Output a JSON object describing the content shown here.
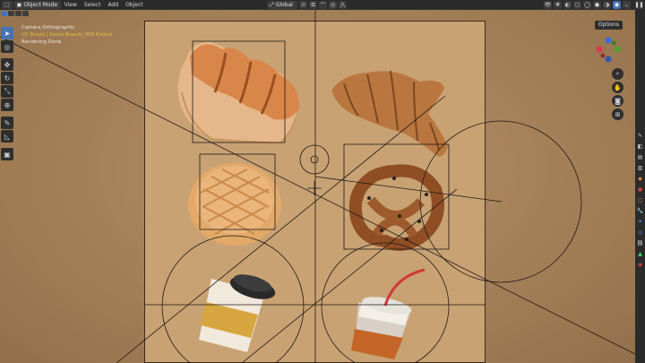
{
  "header": {
    "mode": "Object Mode",
    "menus": [
      "View",
      "Select",
      "Add",
      "Object"
    ],
    "orientation": "Global"
  },
  "viewport": {
    "camera_label": "Camera Orthographic",
    "collection_label": "(0) Bread | Kelsie Breads_009 Pretzel",
    "status": "Rendering Done",
    "options_label": "Options"
  },
  "toolbar": {
    "tools": [
      "select-box-icon",
      "cursor-icon",
      "move-icon",
      "rotate-icon",
      "scale-icon",
      "transform-icon",
      "annotate-icon",
      "measure-icon",
      "add-cube-icon"
    ]
  },
  "nav": {
    "gizmo_axes": [
      "X",
      "Y",
      "Z"
    ],
    "buttons": [
      "zoom-icon",
      "pan-hand-icon",
      "camera-icon",
      "grid-icon"
    ]
  },
  "objects": [
    "bread-loaf",
    "croissant",
    "melon-bun",
    "pretzel",
    "coffee-cup",
    "iced-drink-cup"
  ],
  "colors": {
    "accent": "#4772b3",
    "header_bg": "#2b2b2b",
    "frame_bg": "#c9a274",
    "status_yellow": "#e0c040"
  }
}
